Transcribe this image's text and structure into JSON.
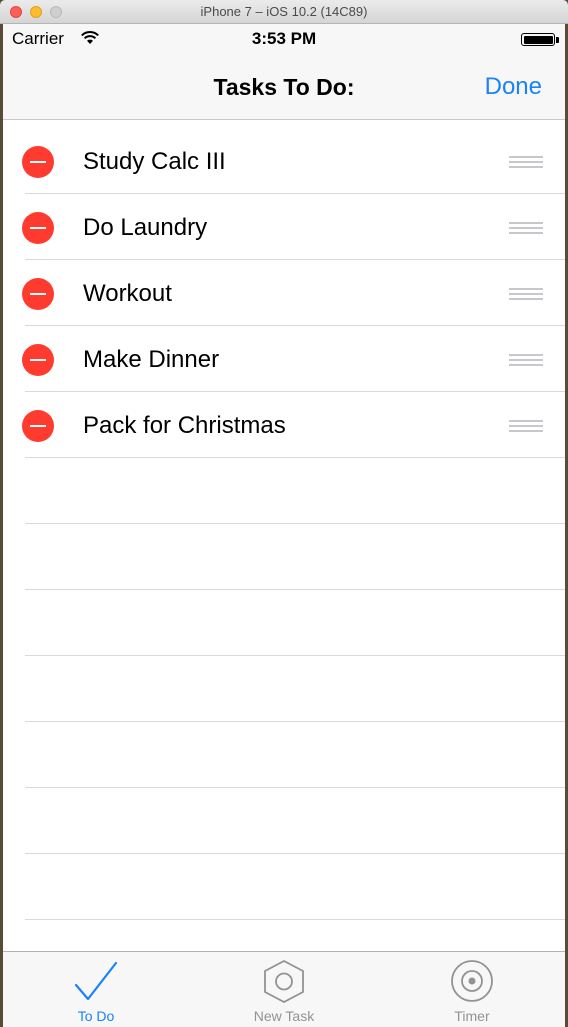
{
  "window": {
    "title": "iPhone 7 – iOS 10.2 (14C89)"
  },
  "status_bar": {
    "carrier": "Carrier",
    "time": "3:53 PM"
  },
  "nav": {
    "title": "Tasks To Do:",
    "done_label": "Done"
  },
  "tasks": [
    {
      "label": "Study Calc III"
    },
    {
      "label": "Do Laundry"
    },
    {
      "label": "Workout"
    },
    {
      "label": "Make Dinner"
    },
    {
      "label": "Pack for Christmas"
    }
  ],
  "tabs": [
    {
      "label": "To Do",
      "icon": "checkmark-icon",
      "active": true
    },
    {
      "label": "New Task",
      "icon": "hexagon-icon",
      "active": false
    },
    {
      "label": "Timer",
      "icon": "target-icon",
      "active": false
    }
  ],
  "colors": {
    "accent": "#1a82fb",
    "delete": "#ff3b30",
    "inactive_tab": "#929292"
  }
}
